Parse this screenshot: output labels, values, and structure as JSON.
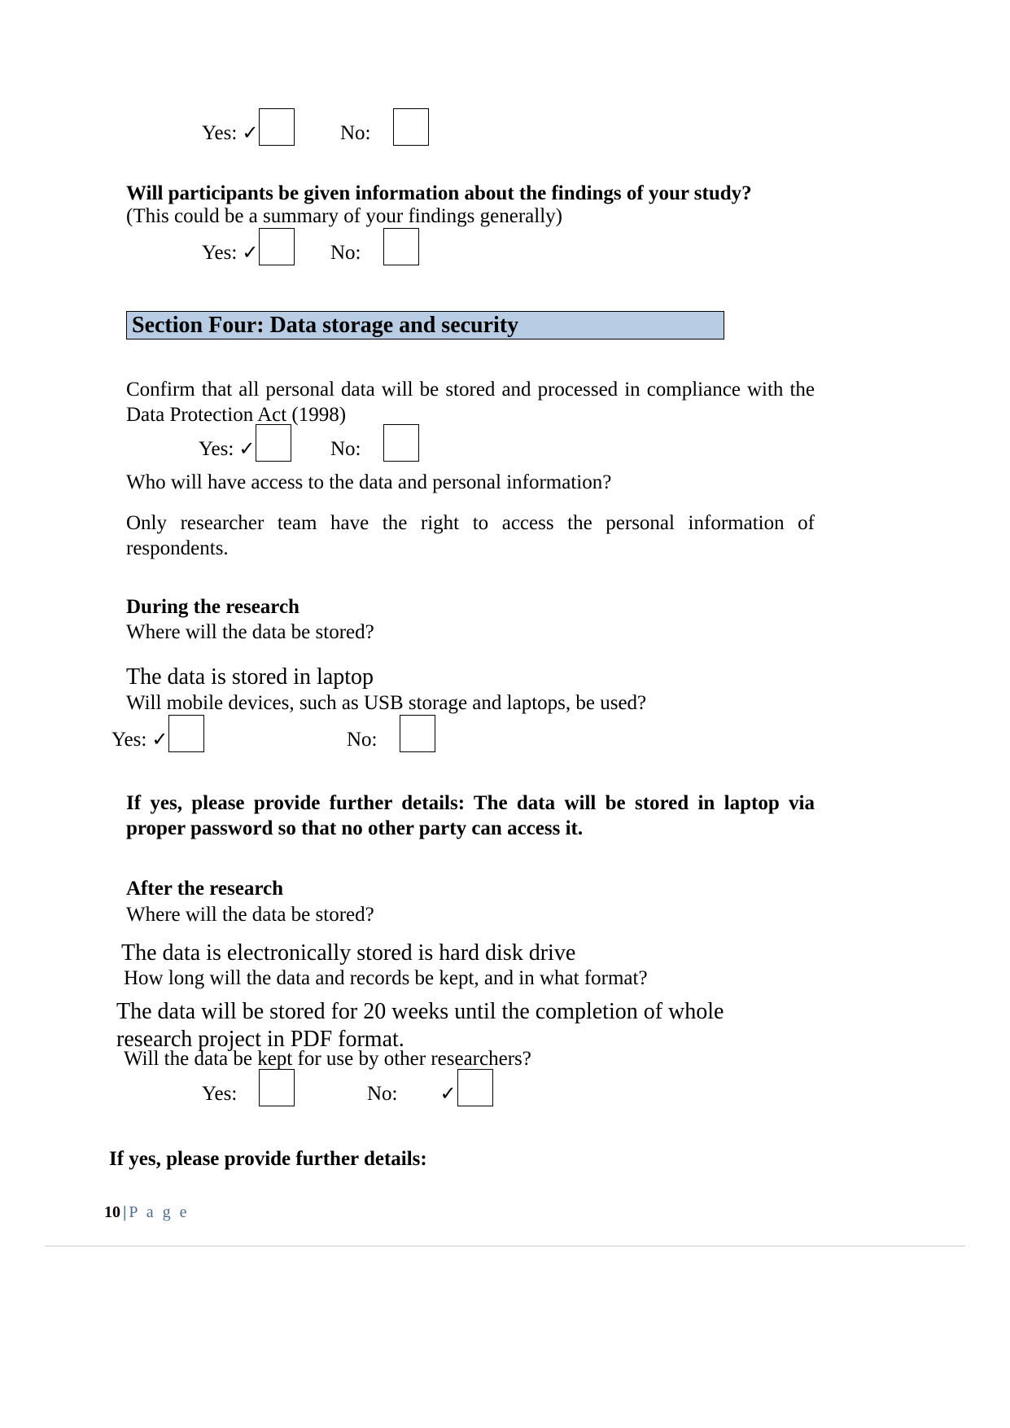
{
  "document": {
    "labels": {
      "yes": "Yes:",
      "no": "No:",
      "check_glyph": "✓"
    },
    "section_banner": {
      "title": "Section Four: Data storage and security",
      "background": "#b8cce4"
    },
    "q_findings": {
      "question": "Will participants be given information about the findings of your study?",
      "note": "(This could be a summary of your findings generally)",
      "answer_checked": "yes"
    },
    "q_top_answer": {
      "answer_checked": "yes"
    },
    "q_dpa": {
      "statement": "Confirm that all personal data will be stored and processed in compliance with the Data Protection Act (1998)",
      "answer_checked": "yes"
    },
    "q_access": {
      "question": "Who will have access to the data and personal information?",
      "answer": "Only researcher team have the right to access the personal information of respondents."
    },
    "during_research": {
      "heading": "During the research",
      "where_question": "Where will the data be stored?",
      "where_answer": "The data is stored in laptop",
      "mobile_question": "Will mobile devices, such as USB storage and laptops, be used?",
      "mobile_answer_checked": "yes",
      "details": "If yes, please provide further details: The data will be stored in laptop via proper password so that no other party can access it."
    },
    "after_research": {
      "heading": "After the research",
      "where_question": "Where will the data be stored?",
      "where_answer": "The data is electronically stored is hard disk drive",
      "duration_question": "How long will the data and records be kept, and in what format?",
      "duration_answer": "The data will be stored for 20 weeks until the completion of whole research project in PDF format.",
      "reuse_question": "Will the data be kept for use by other researchers?",
      "reuse_answer_checked": "no",
      "reuse_details_prompt": "If yes, please provide further details:"
    },
    "footer": {
      "page_number": "10",
      "separator": "|",
      "page_word": "P a g e"
    }
  }
}
